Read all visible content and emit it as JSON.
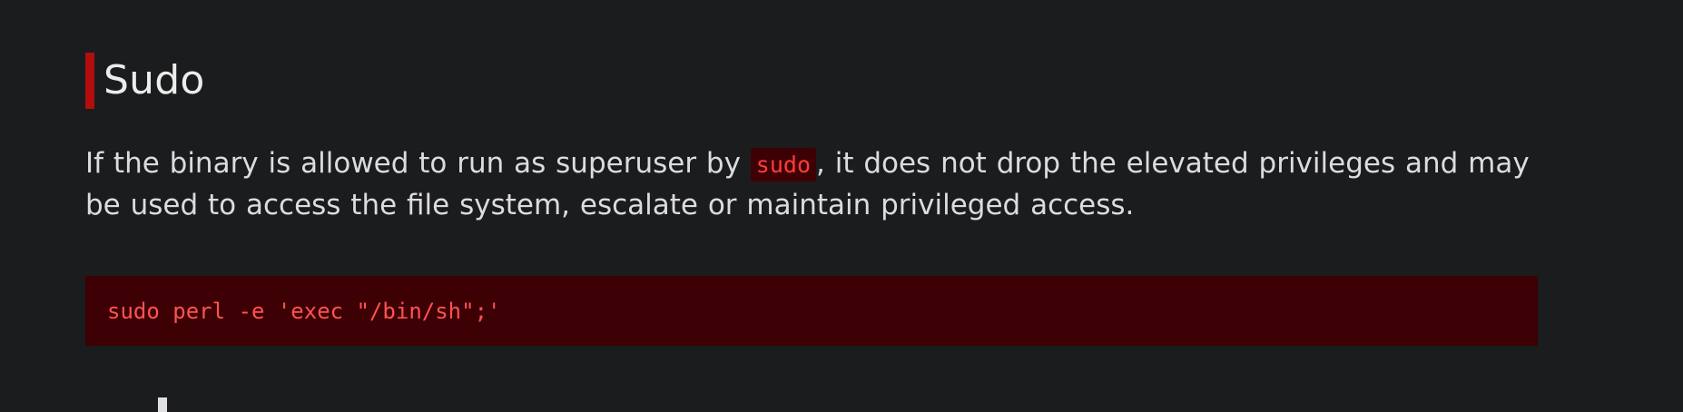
{
  "section": {
    "heading": "Sudo",
    "description_before": "If the binary is allowed to run as superuser by ",
    "inline_code": "sudo",
    "description_after": ", it does not drop the elevated privileges and may be used to access the file system, escalate or maintain privileged access.",
    "code": "sudo perl -e 'exec \"/bin/sh\";'"
  },
  "colors": {
    "background": "#1b1c1e",
    "accent": "#b30d0d",
    "code_background": "#3d0004",
    "code_text": "#ff5252"
  }
}
